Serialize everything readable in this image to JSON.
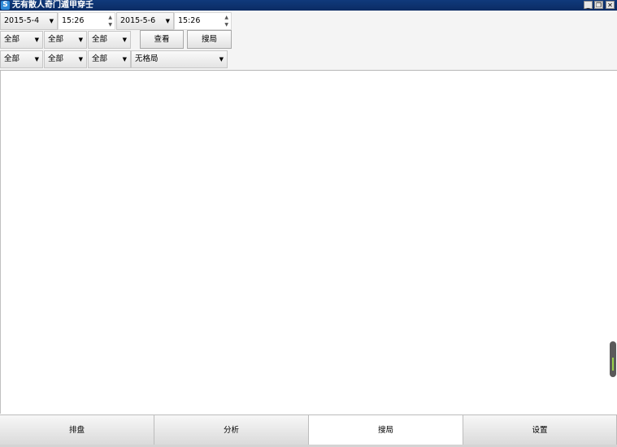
{
  "window": {
    "title": "无有散人奇门遁甲穿壬",
    "icon_glyph": "S",
    "minimize_glyph": "_",
    "restore_glyph": "❐",
    "close_glyph": "✕"
  },
  "filters": {
    "start_date": "2015-5-4",
    "start_time": "15:26",
    "end_date": "2015-5-6",
    "end_time": "15:26",
    "row2": [
      "全部",
      "全部",
      "全部"
    ],
    "row3": [
      "全部",
      "全部",
      "全部"
    ],
    "pattern": "无格局",
    "view_label": "查看",
    "search_label": "搜局"
  },
  "tabs": [
    "排盘",
    "分析",
    "搜局",
    "设置"
  ],
  "active_tab": "搜局",
  "icons": {
    "combo_arrow": "▼",
    "spin_up": "▲",
    "spin_down": "▼"
  },
  "colors": {
    "titlebar": "#0b2b63",
    "scroll_handle": "#5a5a5a",
    "scroll_grip": "#9ad24b"
  }
}
